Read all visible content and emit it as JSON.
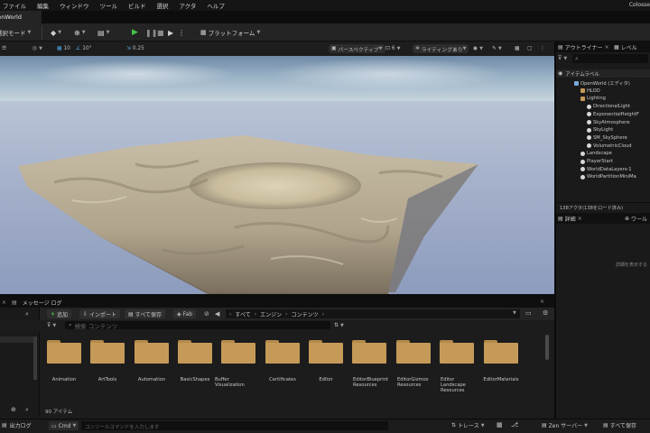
{
  "menu": [
    "ファイル",
    "編集",
    "ウィンドウ",
    "ツール",
    "ビルド",
    "選択",
    "アクタ",
    "ヘルプ"
  ],
  "window_title_right": "Colosse",
  "level_tab": "OpenWorld",
  "toolbar": {
    "select_mode": "選択モード",
    "platforms": "プラットフォーム"
  },
  "viewport_toolbar": {
    "grid_value": "10",
    "rotation_value": "10°",
    "scale_value": "0.25",
    "perspective": "パースペクティブ",
    "lighting": "ライティングあり",
    "camera_speed": "6"
  },
  "outliner": {
    "tab_outliner": "アウトライナー",
    "tab_levels": "レベル",
    "column_label": "アイテムラベル",
    "items": [
      {
        "label": "OpenWorld (エディタ)",
        "indent": 0,
        "icon": "world"
      },
      {
        "label": "HLOD",
        "indent": 1,
        "icon": "folder"
      },
      {
        "label": "Lighting",
        "indent": 1,
        "icon": "folder"
      },
      {
        "label": "DirectionalLight",
        "indent": 2,
        "icon": "actor"
      },
      {
        "label": "ExponentialHeightF",
        "indent": 2,
        "icon": "actor"
      },
      {
        "label": "SkyAtmosphere",
        "indent": 2,
        "icon": "actor"
      },
      {
        "label": "SkyLight",
        "indent": 2,
        "icon": "actor"
      },
      {
        "label": "SM_SkySphere",
        "indent": 2,
        "icon": "actor"
      },
      {
        "label": "VolumetricCloud",
        "indent": 2,
        "icon": "actor"
      },
      {
        "label": "Landscape",
        "indent": 1,
        "icon": "actor"
      },
      {
        "label": "PlayerStart",
        "indent": 1,
        "icon": "actor"
      },
      {
        "label": "WorldDataLayers-1",
        "indent": 1,
        "icon": "actor"
      },
      {
        "label": "WorldPartitionMiniMa",
        "indent": 1,
        "icon": "actor"
      }
    ],
    "actor_count": "138アクタ(138をロード済み)"
  },
  "details": {
    "tab_details": "詳細",
    "tab_world": "ワール",
    "hint": "詳細を表示する"
  },
  "content_browser": {
    "tab_label": "メッセージ ログ",
    "add": "追加",
    "import": "インポート",
    "save_all": "すべて保存",
    "fab": "Fab",
    "path": [
      "すべて",
      "エンジン",
      "コンテンツ"
    ],
    "search_placeholder": "検索 コンテンツ",
    "item_count": "90 アイテム",
    "folders": [
      "Animation",
      "ArtTools",
      "Automation",
      "BasicShapes",
      "Buffer Visualization",
      "Certificates",
      "Editor",
      "EditorBlueprint Resources",
      "EditorGizmos Resources",
      "Editor Landscape Resources",
      "EditorMaterials"
    ]
  },
  "statusbar": {
    "output_log": "出力ログ",
    "cmd": "Cmd",
    "console_placeholder": "コンソールコマンドを入力します",
    "trace": "トレース",
    "zen_server": "Zen サーバー",
    "save_all": "すべて保存"
  },
  "colors": {
    "accent_green": "#46c34a",
    "folder": "#c59a58",
    "panel": "#1c1c1c"
  }
}
